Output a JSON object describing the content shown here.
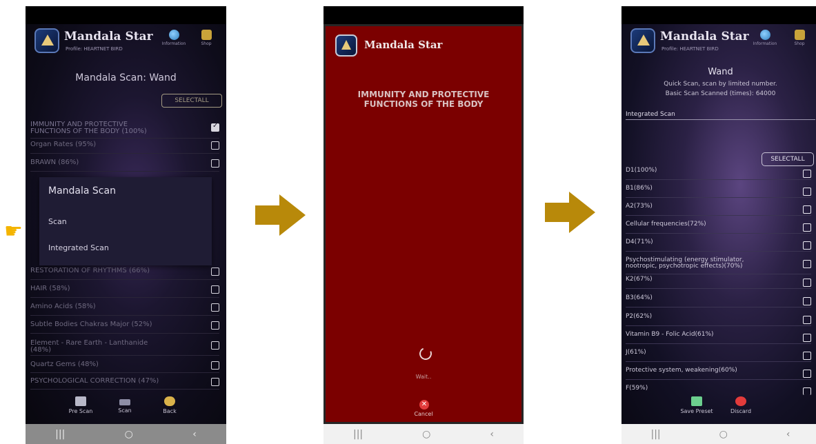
{
  "left": {
    "app_title": "Mandala Star",
    "profile": "Profile: HEARTNET BIRD",
    "info_label": "Information",
    "shop_label": "Shop",
    "title": "Mandala Scan: Wand",
    "selectall": "SELECTALL",
    "rows": [
      {
        "label": "IMMUNITY AND PROTECTIVE FUNCTIONS OF THE BODY (100%)",
        "checked": true
      },
      {
        "label": "Organ Rates (95%)",
        "checked": false
      },
      {
        "label": "BRAWN (86%)",
        "checked": false
      },
      {
        "label": "RESTORATION OF RHYTHMS (66%)",
        "checked": false
      },
      {
        "label": "HAIR (58%)",
        "checked": false
      },
      {
        "label": "Amino Acids (58%)",
        "checked": false
      },
      {
        "label": "Subtle Bodies Chakras Major (52%)",
        "checked": false
      },
      {
        "label": "Element - Rare Earth - Lanthanide (48%)",
        "checked": false
      },
      {
        "label": "Quartz Gems (48%)",
        "checked": false
      },
      {
        "label": "PSYCHOLOGICAL CORRECTION (47%)",
        "checked": false
      }
    ],
    "popup": {
      "title": "Mandala Scan",
      "item1": "Scan",
      "item2": "Integrated Scan"
    },
    "bottom": {
      "prescan": "Pre Scan",
      "scan": "Scan",
      "back": "Back"
    }
  },
  "middle": {
    "app_title": "Mandala Star",
    "heading": "IMMUNITY AND PROTECTIVE FUNCTIONS OF THE BODY",
    "wait": "Wait..",
    "cancel": "Cancel"
  },
  "right": {
    "app_title": "Mandala Star",
    "profile": "Profile: HEARTNET BIRD",
    "info_label": "Information",
    "shop_label": "Shop",
    "title": "Wand",
    "sub1": "Quick Scan, scan by limited number.",
    "sub2": "Basic Scan Scanned (times): 64000",
    "integrated": "Integrated Scan",
    "selectall": "SELECTALL",
    "rows": [
      "D1(100%)",
      "B1(86%)",
      "A2(73%)",
      "Cellular frequencies(72%)",
      "D4(71%)",
      "Psychostimulating (energy stimulator, nootropic, psychotropic effects)(70%)",
      "K2(67%)",
      "B3(64%)",
      "P2(62%)",
      "Vitamin B9 - Folic Acid(61%)",
      "J(61%)",
      "Protective system, weakening(60%)",
      "F(59%)"
    ],
    "bottom": {
      "save": "Save Preset",
      "discard": "Discard"
    }
  },
  "nav": {
    "recent": "|||",
    "home": "○",
    "back": "‹"
  }
}
